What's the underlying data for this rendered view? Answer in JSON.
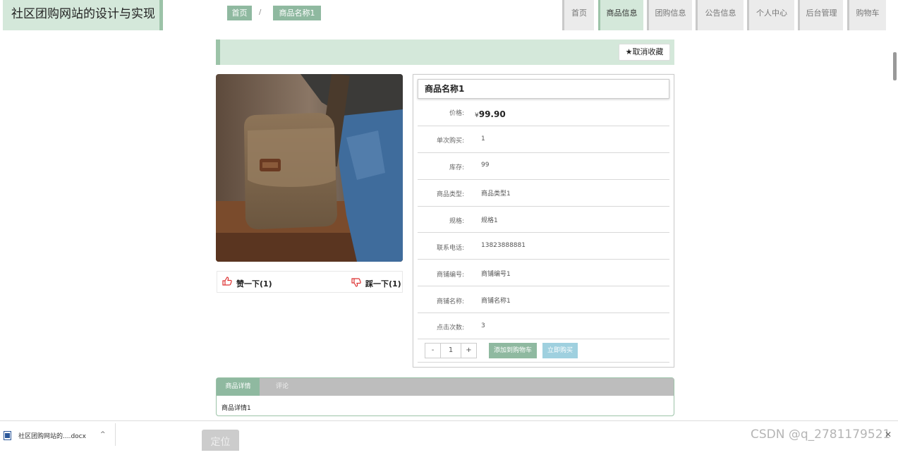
{
  "header": {
    "site_title": "社区团购网站的设计与实现",
    "nav": [
      "首页",
      "商品信息",
      "团购信息",
      "公告信息",
      "个人中心",
      "后台管理",
      "购物车"
    ],
    "active_nav": "商品信息"
  },
  "breadcrumb": {
    "home": "首页",
    "separator": "/",
    "current": "商品名称1"
  },
  "favorite": {
    "star": "★",
    "label": "取消收藏"
  },
  "votes": {
    "like": "赞一下(1)",
    "dislike": "踩一下(1)"
  },
  "product": {
    "name": "商品名称1",
    "price_label": "价格:",
    "price_currency": "¥",
    "price_value": "99.90",
    "rows": [
      {
        "label": "单次购买:",
        "value": "1"
      },
      {
        "label": "库存:",
        "value": "99"
      },
      {
        "label": "商品类型:",
        "value": "商品类型1"
      },
      {
        "label": "规格:",
        "value": "规格1"
      },
      {
        "label": "联系电话:",
        "value": "13823888881"
      },
      {
        "label": "商铺编号:",
        "value": "商铺编号1"
      },
      {
        "label": "商铺名称:",
        "value": "商铺名称1"
      },
      {
        "label": "点击次数:",
        "value": "3"
      }
    ]
  },
  "purchase": {
    "minus": "-",
    "quantity": "1",
    "plus": "+",
    "add_to_cart": "添加到购物车",
    "buy_now": "立即购买"
  },
  "tabs": {
    "items": [
      "商品详情",
      "评论"
    ],
    "active": "商品详情",
    "content": "商品详情1"
  },
  "download_bar": {
    "file_name": "社区团购网站的....docx",
    "chevron": "^",
    "locate": "定位"
  },
  "watermark": "CSDN @q_2781179521",
  "colors": {
    "theme_light": "#d4e8da",
    "theme_accent": "#9cc3a8",
    "button_green": "#8fb9a0",
    "button_blue": "#9fd0df"
  }
}
